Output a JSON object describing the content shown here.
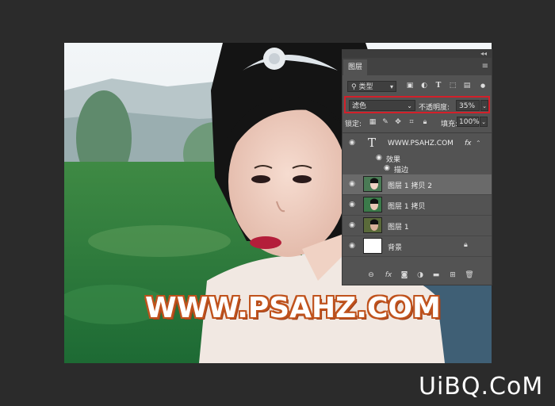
{
  "watermark": "WWW.PSAHZ.COM",
  "site_logo": "UiBQ.CoM",
  "panel": {
    "tab": "图层",
    "collapse_glyph": "◂◂",
    "menu_glyph": "≡",
    "filter": {
      "kind_label": "类型",
      "icons": [
        "image-filter-icon",
        "adjust-filter-icon",
        "type-filter-icon",
        "shape-filter-icon",
        "smart-filter-icon"
      ]
    },
    "blend_mode": "滤色",
    "opacity_label": "不透明度:",
    "opacity_value": "35%",
    "lock_label": "锁定:",
    "fill_label": "填充:",
    "fill_value": "100%",
    "layers": [
      {
        "name": "WWW.PSAHZ.COM",
        "type": "text",
        "fx": "fx",
        "effects_label": "效果",
        "effect": "描边"
      },
      {
        "name": "图层 1 拷贝 2",
        "selected": true
      },
      {
        "name": "图层 1 拷贝"
      },
      {
        "name": "图层 1"
      },
      {
        "name": "背景",
        "locked": true
      }
    ],
    "bottom_icons": [
      "link-icon",
      "fx-icon",
      "mask-icon",
      "adjustment-icon",
      "folder-icon",
      "new-layer-icon",
      "trash-icon"
    ]
  }
}
